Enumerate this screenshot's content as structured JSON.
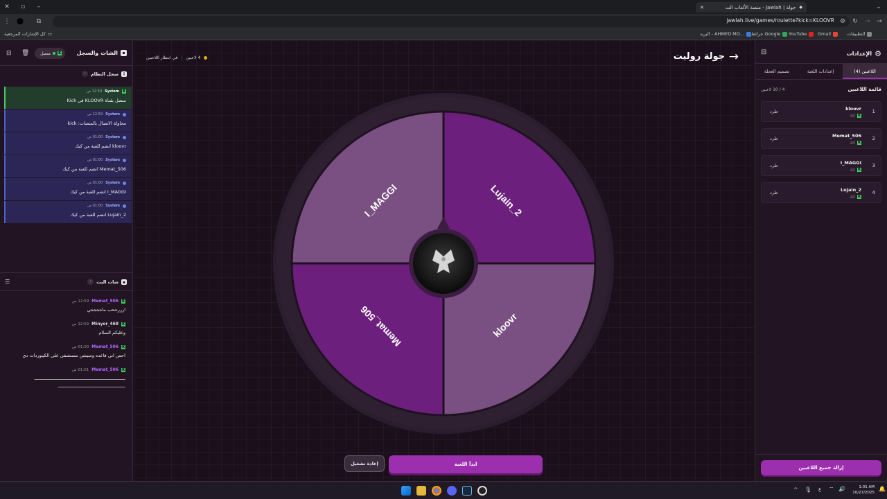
{
  "browser": {
    "tab_title": "جولة | Jawlah - منصة الألعاب الت",
    "url": "jawlah.live/games/roulette?kick=KLOOVR",
    "bookmarks": [
      "التطبيقات",
      "Gmail",
      "YouTube",
      "خرائط Google",
      "البريد - AHMED MO..."
    ],
    "bookmarks_folder": "كل الإشارات المرجعية"
  },
  "left_panel": {
    "title": "الشات والسجل",
    "status": "متصل",
    "system_log_title": "سجل النظام",
    "system_log": [
      {
        "source": "System",
        "time": "12:59 ص",
        "message": "متصل بقناة KLOOVR في Kick",
        "kind": "success"
      },
      {
        "source": "System",
        "time": "12:59 ص",
        "message": "محاولة الاتصال بالمنصات: kick",
        "kind": "info"
      },
      {
        "source": "System",
        "time": "01:00 ص",
        "message": "kloovr انضم للعبة من كيك",
        "kind": "info"
      },
      {
        "source": "System",
        "time": "01:00 ص",
        "message": "Memat_506 انضم للعبة من كيك",
        "kind": "info"
      },
      {
        "source": "System",
        "time": "01:00 ص",
        "message": "I_MAGGI انضم للعبة من كيك",
        "kind": "info"
      },
      {
        "source": "System",
        "time": "01:00 ص",
        "message": "Lujain_2 انضم للعبة من كيك",
        "kind": "info"
      }
    ],
    "live_chat_title": "شات البث",
    "chat": [
      {
        "user": "Memat_506",
        "time": "12:59 ص",
        "text": "ارررححب ماججججي",
        "color": "#b06bff"
      },
      {
        "user": "Minyor_468",
        "time": "12:59 ص",
        "text": "وعليكم السلام",
        "color": "#8ad0ff"
      },
      {
        "user": "Memat_506",
        "time": "01:00 ص",
        "text": "احس اني قاعده وسيشن مستشفى على الكيبوردات دي",
        "color": "#b06bff"
      },
      {
        "user": "Memat_506",
        "time": "01:01 ص",
        "text": "ـــــــــــــــــــــــــــــــــــــــــــــــــــــــــــــــــــــ",
        "text2": "ـــــــــــــــــــــــــــــــــــــــــــــــــــ",
        "color": "#b06bff"
      }
    ]
  },
  "center": {
    "title": "جولة روليت",
    "players_count": "4 لاعبين",
    "waiting": "في انتظار اللاعبين",
    "wheel_segments": [
      "Lujain_2",
      "kloovr",
      "Memat_506",
      "I_MAGGI"
    ],
    "segment_colors": [
      "#6c1f7d",
      "#7a4f82",
      "#6c1f7d",
      "#7a4f82"
    ],
    "start_button": "ابدأ اللعبة",
    "restart_button": "إعادة تشغيل"
  },
  "right_panel": {
    "title": "الإعدادات",
    "tabs": [
      "اللاعبين (4)",
      "إعدادات اللعبة",
      "تصميم العجلة"
    ],
    "players_list_title": "قائمة اللاعبين",
    "players_count": "4 / 10 لاعبين",
    "players": [
      {
        "num": "1",
        "name": "kloovr",
        "platform": "كيك",
        "kick_label": "طرد"
      },
      {
        "num": "2",
        "name": "Memat_506",
        "platform": "كيك",
        "kick_label": "طرد"
      },
      {
        "num": "3",
        "name": "I_MAGGI",
        "platform": "كيك",
        "kick_label": "طرد"
      },
      {
        "num": "4",
        "name": "Lujain_2",
        "platform": "كيك",
        "kick_label": "طرد"
      }
    ],
    "remove_all_button": "إزالة جميع اللاعبين"
  },
  "taskbar": {
    "lang": "ع",
    "time": "1:01 AM",
    "date": "10/27/2025"
  },
  "colors": {
    "accent": "#9b2fae",
    "kick_green": "#3fd163"
  }
}
